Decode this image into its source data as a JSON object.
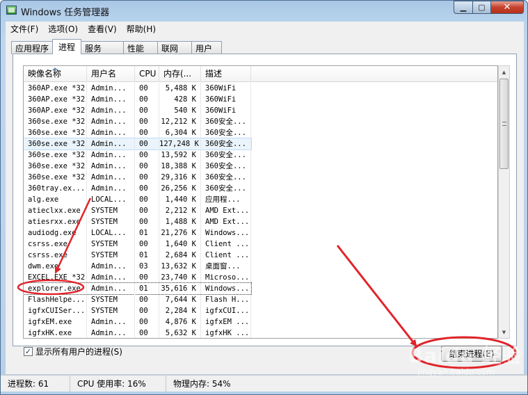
{
  "window": {
    "title": "Windows 任务管理器",
    "minimize": "▁",
    "maximize": "▢",
    "close": "✕"
  },
  "menu": [
    "文件(F)",
    "选项(O)",
    "查看(V)",
    "帮助(H)"
  ],
  "tabs": [
    {
      "label": "应用程序",
      "active": false
    },
    {
      "label": "进程",
      "active": true
    },
    {
      "label": "服务",
      "active": false
    },
    {
      "label": "性能",
      "active": false
    },
    {
      "label": "联网",
      "active": false
    },
    {
      "label": "用户",
      "active": false
    }
  ],
  "table": {
    "columns": [
      "映像名称",
      "用户名",
      "CPU",
      "内存(...",
      "描述"
    ],
    "rows": [
      [
        "360AP.exe *32",
        "Admin...",
        "00",
        "5,488 K",
        "360WiFi"
      ],
      [
        "360AP.exe *32",
        "Admin...",
        "00",
        "428 K",
        "360WiFi"
      ],
      [
        "360AP.exe *32",
        "Admin...",
        "00",
        "540 K",
        "360WiFi"
      ],
      [
        "360se.exe *32",
        "Admin...",
        "00",
        "12,212 K",
        "360安全..."
      ],
      [
        "360se.exe *32",
        "Admin...",
        "00",
        "6,304 K",
        "360安全..."
      ],
      [
        "360se.exe *32",
        "Admin...",
        "00",
        "127,248 K",
        "360安全..."
      ],
      [
        "360se.exe *32",
        "Admin...",
        "00",
        "13,592 K",
        "360安全..."
      ],
      [
        "360se.exe *32",
        "Admin...",
        "00",
        "18,388 K",
        "360安全..."
      ],
      [
        "360se.exe *32",
        "Admin...",
        "00",
        "29,316 K",
        "360安全..."
      ],
      [
        "360tray.ex...",
        "Admin...",
        "00",
        "26,256 K",
        "360安全..."
      ],
      [
        "alg.exe",
        "LOCAL...",
        "00",
        "1,440 K",
        "应用程..."
      ],
      [
        "atieclxx.exe",
        "SYSTEM",
        "00",
        "2,212 K",
        "AMD Ext..."
      ],
      [
        "atiesrxx.exe",
        "SYSTEM",
        "00",
        "1,488 K",
        "AMD Ext..."
      ],
      [
        "audiodg.exe",
        "LOCAL...",
        "01",
        "21,276 K",
        "Windows..."
      ],
      [
        "csrss.exe",
        "SYSTEM",
        "00",
        "1,640 K",
        "Client ..."
      ],
      [
        "csrss.exe",
        "SYSTEM",
        "01",
        "2,684 K",
        "Client ..."
      ],
      [
        "dwm.exe",
        "Admin...",
        "03",
        "13,632 K",
        "桌面窗..."
      ],
      [
        "EXCEL.EXE *32",
        "Admin...",
        "00",
        "23,740 K",
        "Microso..."
      ],
      [
        "explorer.exe",
        "Admin...",
        "01",
        "35,616 K",
        "Windows..."
      ],
      [
        "FlashHelpe...",
        "SYSTEM",
        "00",
        "7,644 K",
        "Flash H..."
      ],
      [
        "igfxCUISer...",
        "SYSTEM",
        "00",
        "2,284 K",
        "igfxCUI..."
      ],
      [
        "igfxEM.exe",
        "Admin...",
        "00",
        "4,876 K",
        "igfxEM ..."
      ],
      [
        "igfxHK.exe",
        "Admin...",
        "00",
        "5,632 K",
        "igfxHK ..."
      ]
    ],
    "hover_row": 5,
    "selected_row": 18
  },
  "show_all_users": {
    "label": "显示所有用户的进程(S)",
    "checked": true,
    "mark": "✓"
  },
  "end_process_button": "结束进程(E)",
  "status": {
    "processes": "进程数: 61",
    "cpu": "CPU 使用率: 16%",
    "memory": "物理内存: 54%"
  },
  "scroll_arrows": {
    "up": "▲",
    "down": "▼"
  },
  "watermark": {
    "text": "Baidu 经验",
    "sub": "jingyan.baidu.com"
  },
  "colors": {
    "annotation_red": "#e0242a"
  }
}
